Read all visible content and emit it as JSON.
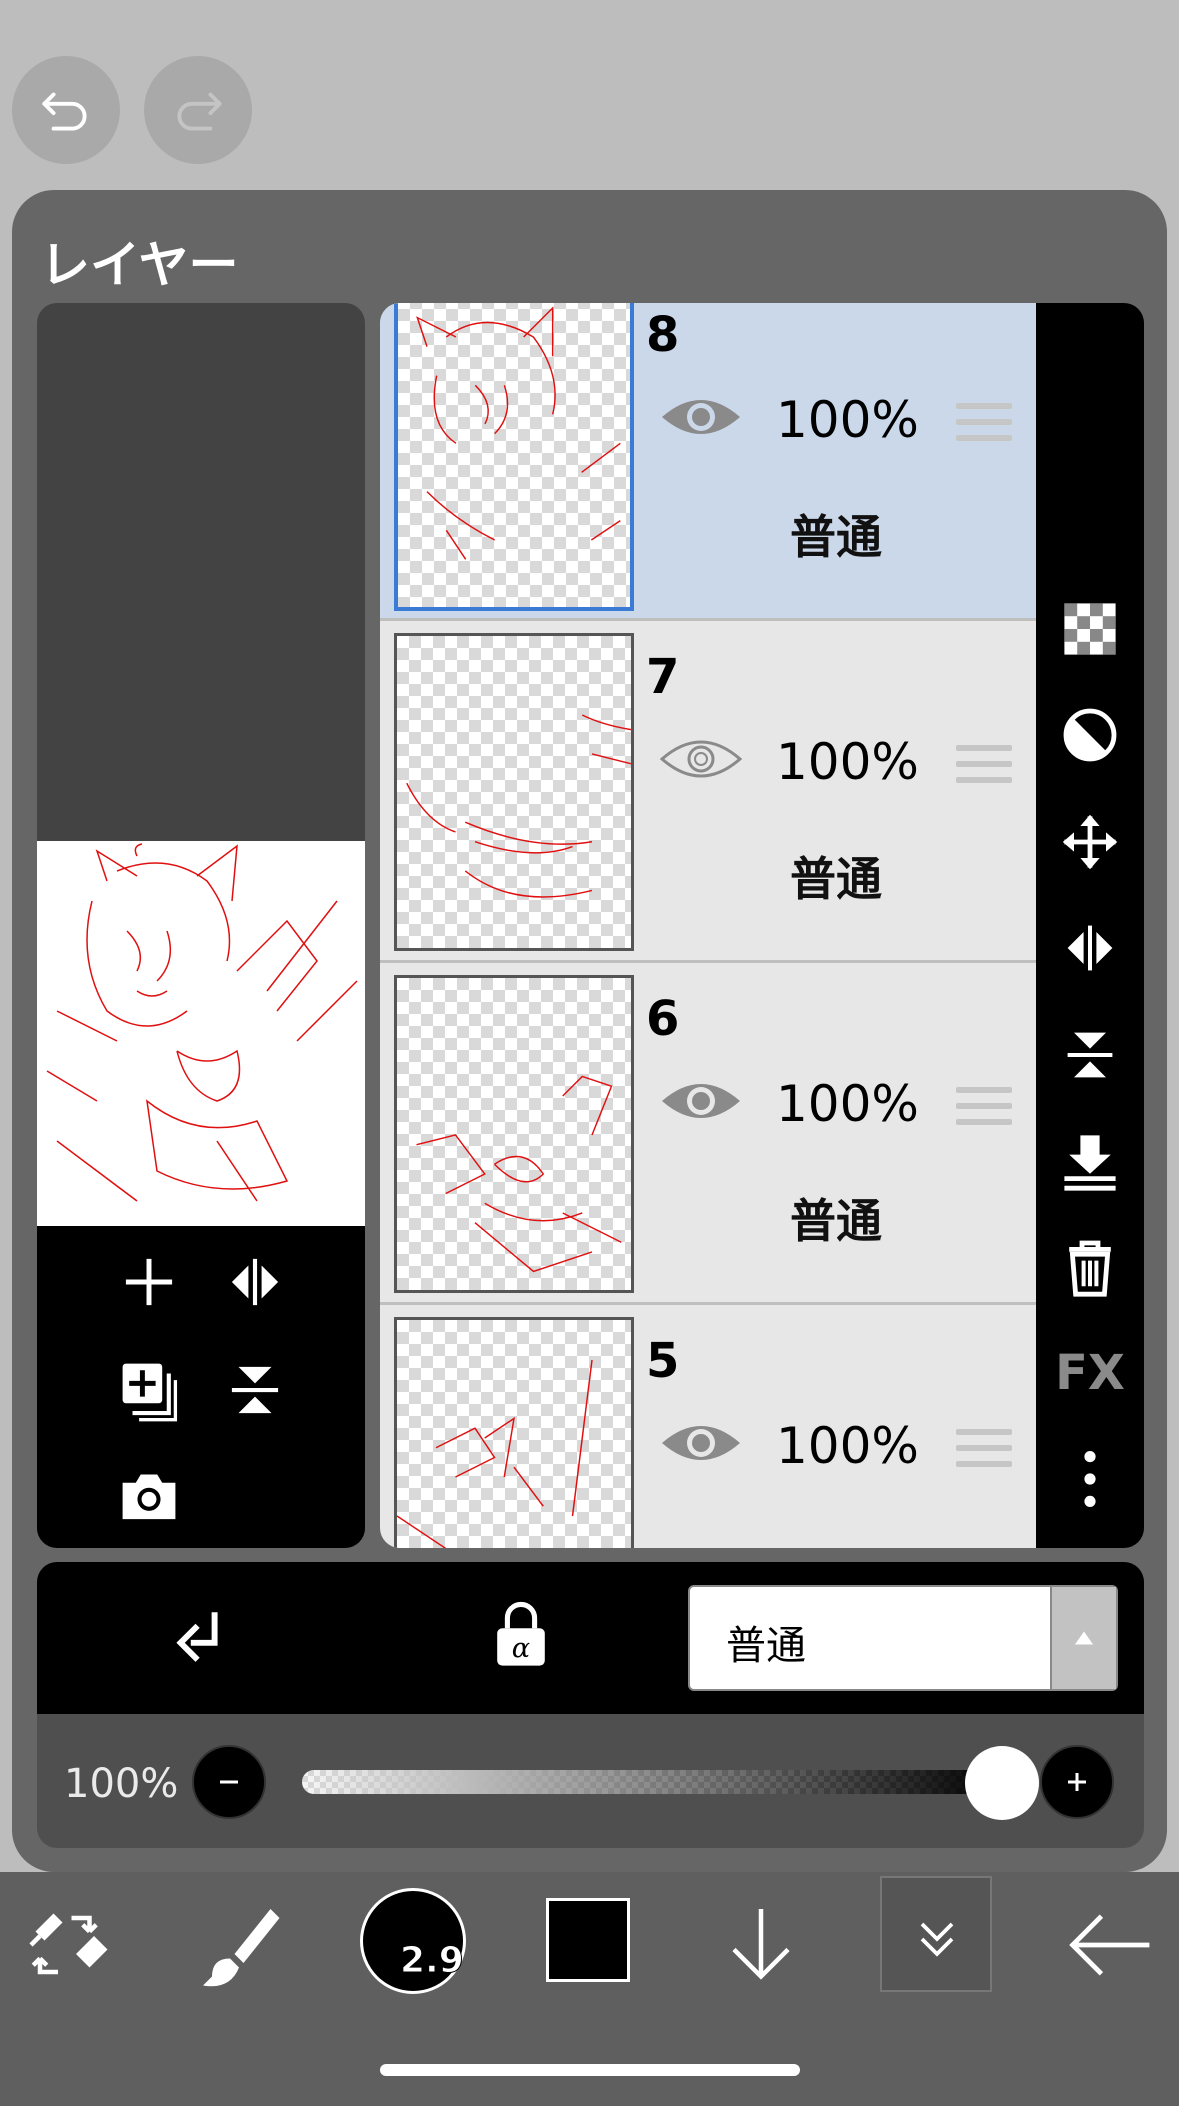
{
  "panel": {
    "title": "レイヤー"
  },
  "layers": [
    {
      "number": "8",
      "opacity": "100%",
      "blend": "普通",
      "selected": true
    },
    {
      "number": "7",
      "opacity": "100%",
      "blend": "普通",
      "selected": false
    },
    {
      "number": "6",
      "opacity": "100%",
      "blend": "普通",
      "selected": false
    },
    {
      "number": "5",
      "opacity": "100%",
      "blend": "",
      "selected": false
    }
  ],
  "right_toolstrip": {
    "fx_label": "FX"
  },
  "blend_mode": {
    "selected": "普通"
  },
  "opacity_control": {
    "label": "100%",
    "value": 1.0
  },
  "bottom_toolbar": {
    "brush_size": "2.9",
    "color": "#000000"
  },
  "colors": {
    "accent_blue": "#3a7bd5",
    "selected_row": "#cbd8ea",
    "sketch_red": "#e01010"
  }
}
